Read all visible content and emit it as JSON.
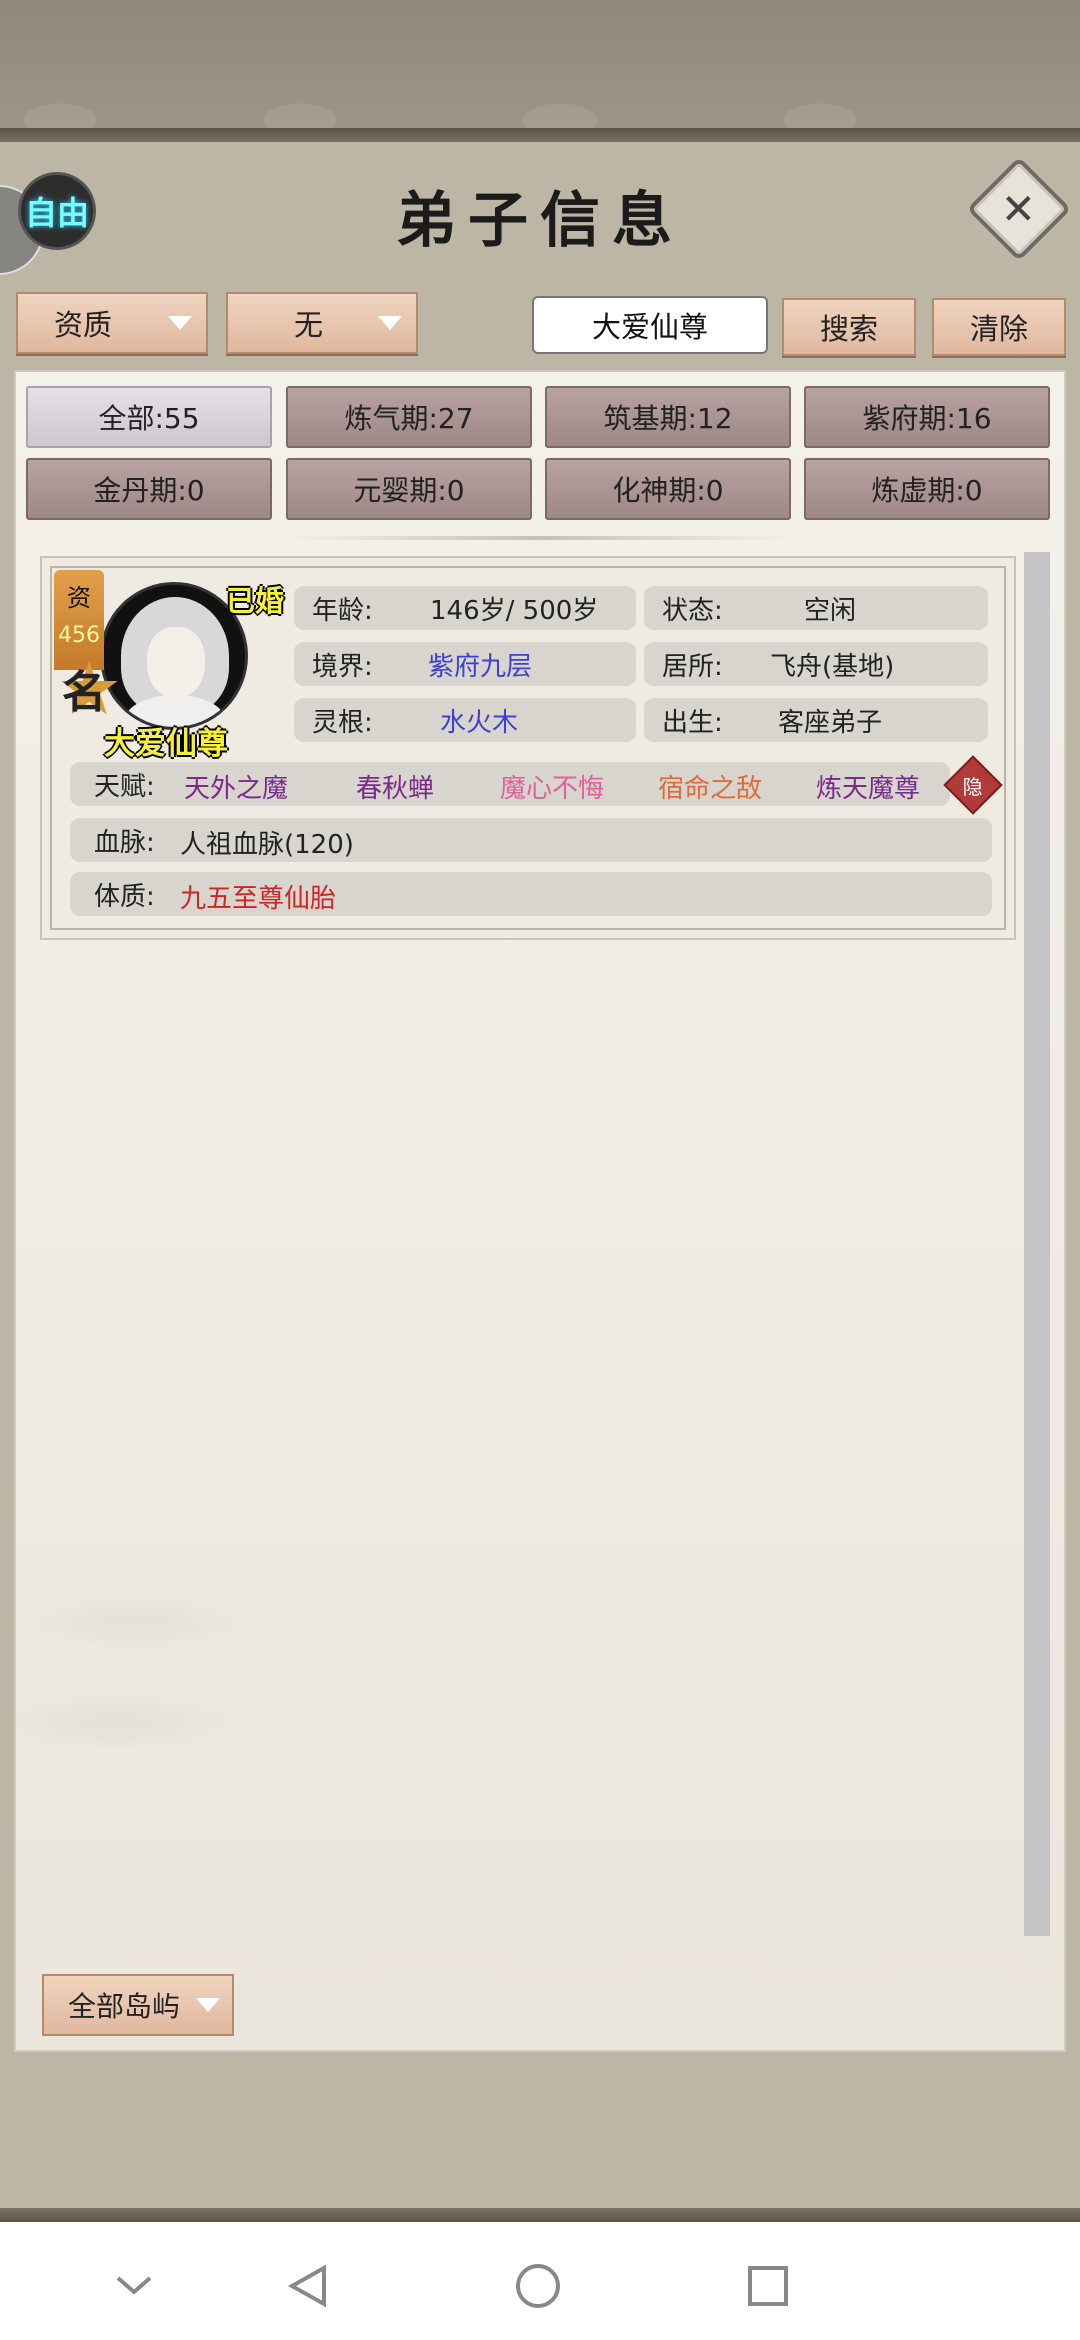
{
  "header": {
    "free_badge": "自由",
    "title": "弟子信息",
    "close_icon": "close-icon"
  },
  "filters": {
    "sort_dropdown": "资质",
    "secondary_dropdown": "无",
    "search_value": "大爱仙尊",
    "search_button": "搜索",
    "clear_button": "清除"
  },
  "stage_tabs": [
    {
      "label": "全部:55",
      "active": true
    },
    {
      "label": "炼气期:27",
      "active": false
    },
    {
      "label": "筑基期:12",
      "active": false
    },
    {
      "label": "紫府期:16",
      "active": false
    },
    {
      "label": "金丹期:0",
      "active": false
    },
    {
      "label": "元婴期:0",
      "active": false
    },
    {
      "label": "化神期:0",
      "active": false
    },
    {
      "label": "炼虚期:0",
      "active": false
    }
  ],
  "disciple": {
    "aptitude_label": "资",
    "aptitude_value": "456",
    "fame_label": "名",
    "married": "已婚",
    "name": "大爱仙尊",
    "age_key": "年龄:",
    "age_value": "146岁/ 500岁",
    "status_key": "状态:",
    "status_value": "空闲",
    "realm_key": "境界:",
    "realm_value": "紫府九层",
    "residence_key": "居所:",
    "residence_value": "飞舟(基地)",
    "root_key": "灵根:",
    "root_value": "水火木",
    "birth_key": "出生:",
    "birth_value": "客座弟子",
    "talent_key": "天赋:",
    "talents": [
      "天外之魔",
      "春秋蝉",
      "魔心不悔",
      "宿命之敌",
      "炼天魔尊"
    ],
    "hide_button": "隐",
    "bloodline_key": "血脉:",
    "bloodline_value": "人祖血脉(120)",
    "physique_key": "体质:",
    "physique_value": "九五至尊仙胎"
  },
  "footer": {
    "island_dropdown": "全部岛屿"
  },
  "colors": {
    "accent_peach": "#e0b89d",
    "tab_mauve": "#9e8787",
    "blue_value": "#3f3fd0",
    "purple_talent": "#7a2a8a",
    "pink_talent": "#e0609a",
    "orange_talent": "#e06a3a",
    "red_physique": "#d02424",
    "name_yellow": "#f7ef40"
  },
  "navbar": {
    "icons": [
      "chevron-down-icon",
      "back-icon",
      "home-icon",
      "recents-icon"
    ]
  }
}
